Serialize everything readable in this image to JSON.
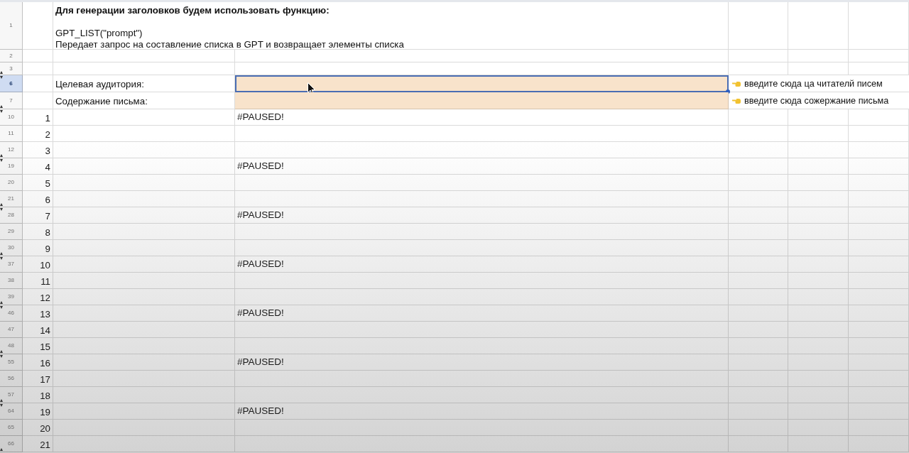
{
  "rows": [
    {
      "header": "1",
      "kind": "intro",
      "selected": false,
      "hidden_before": false,
      "hidden_after": false,
      "title": "Для генерации заголовков будем использовать функцию:",
      "formula": "GPT_LIST(\"prompt\")",
      "description": "Передает запрос на составление списка в GPT и возвращает элементы списка"
    },
    {
      "header": "2",
      "kind": "blank",
      "selected": false,
      "hidden_before": false,
      "hidden_after": false
    },
    {
      "header": "3",
      "kind": "blank",
      "selected": false,
      "hidden_before": false,
      "hidden_after": true
    },
    {
      "header": "6",
      "kind": "input",
      "selected": true,
      "hidden_before": true,
      "hidden_after": false,
      "label": "Целевая аудитория:",
      "note": "введите сюда ца читателй писем"
    },
    {
      "header": "7",
      "kind": "input",
      "selected": false,
      "hidden_before": false,
      "hidden_after": true,
      "label": "Содержание письма:",
      "note": "введите сюда сожержание письма"
    },
    {
      "header": "10",
      "kind": "item",
      "selected": false,
      "hidden_before": true,
      "hidden_after": false,
      "index": "1",
      "result": "#PAUSED!"
    },
    {
      "header": "11",
      "kind": "item",
      "selected": false,
      "hidden_before": false,
      "hidden_after": false,
      "index": "2"
    },
    {
      "header": "12",
      "kind": "item",
      "selected": false,
      "hidden_before": false,
      "hidden_after": true,
      "index": "3"
    },
    {
      "header": "19",
      "kind": "item",
      "selected": false,
      "hidden_before": true,
      "hidden_after": false,
      "index": "4",
      "result": "#PAUSED!"
    },
    {
      "header": "20",
      "kind": "item",
      "selected": false,
      "hidden_before": false,
      "hidden_after": false,
      "index": "5"
    },
    {
      "header": "21",
      "kind": "item",
      "selected": false,
      "hidden_before": false,
      "hidden_after": true,
      "index": "6"
    },
    {
      "header": "28",
      "kind": "item",
      "selected": false,
      "hidden_before": true,
      "hidden_after": false,
      "index": "7",
      "result": "#PAUSED!"
    },
    {
      "header": "29",
      "kind": "item",
      "selected": false,
      "hidden_before": false,
      "hidden_after": false,
      "index": "8"
    },
    {
      "header": "30",
      "kind": "item",
      "selected": false,
      "hidden_before": false,
      "hidden_after": true,
      "index": "9"
    },
    {
      "header": "37",
      "kind": "item",
      "selected": false,
      "hidden_before": true,
      "hidden_after": false,
      "index": "10",
      "result": "#PAUSED!"
    },
    {
      "header": "38",
      "kind": "item",
      "selected": false,
      "hidden_before": false,
      "hidden_after": false,
      "index": "11"
    },
    {
      "header": "39",
      "kind": "item",
      "selected": false,
      "hidden_before": false,
      "hidden_after": true,
      "index": "12"
    },
    {
      "header": "46",
      "kind": "item",
      "selected": false,
      "hidden_before": true,
      "hidden_after": false,
      "index": "13",
      "result": "#PAUSED!"
    },
    {
      "header": "47",
      "kind": "item",
      "selected": false,
      "hidden_before": false,
      "hidden_after": false,
      "index": "14"
    },
    {
      "header": "48",
      "kind": "item",
      "selected": false,
      "hidden_before": false,
      "hidden_after": true,
      "index": "15"
    },
    {
      "header": "55",
      "kind": "item",
      "selected": false,
      "hidden_before": true,
      "hidden_after": false,
      "index": "16",
      "result": "#PAUSED!"
    },
    {
      "header": "56",
      "kind": "item",
      "selected": false,
      "hidden_before": false,
      "hidden_after": false,
      "index": "17"
    },
    {
      "header": "57",
      "kind": "item",
      "selected": false,
      "hidden_before": false,
      "hidden_after": true,
      "index": "18"
    },
    {
      "header": "64",
      "kind": "item",
      "selected": false,
      "hidden_before": true,
      "hidden_after": false,
      "index": "19",
      "result": "#PAUSED!"
    },
    {
      "header": "65",
      "kind": "item",
      "selected": false,
      "hidden_before": false,
      "hidden_after": false,
      "index": "20"
    },
    {
      "header": "66",
      "kind": "item",
      "selected": false,
      "hidden_before": false,
      "hidden_after": true,
      "index": "21"
    }
  ]
}
